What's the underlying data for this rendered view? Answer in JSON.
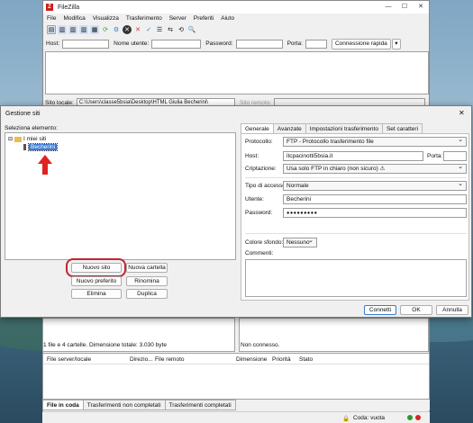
{
  "app": {
    "title": "FileZilla",
    "menu": [
      "File",
      "Modifica",
      "Visualizza",
      "Trasferimento",
      "Server",
      "Preferiti",
      "Aiuto"
    ],
    "window_buttons": [
      "—",
      "☐",
      "✕"
    ]
  },
  "quickconnect": {
    "host_label": "Host:",
    "user_label": "Nome utente:",
    "password_label": "Password:",
    "port_label": "Porta:",
    "connect_button": "Connessione rapida",
    "dropdown_arrow": "▾"
  },
  "local_site": {
    "label": "Sito locale:",
    "path": "C:\\Users\\classe5bsia\\Desktop\\HTML Giulia Becherini\\"
  },
  "remote_site": {
    "label": "Sito remoto:"
  },
  "status": {
    "local": "1 file e 4 cartelle. Dimensione totale: 3.030 byte",
    "remote": "Non connesso.",
    "queue": "Coda: vuota"
  },
  "queue_columns": [
    "File server/locale",
    "Direzio...",
    "File remoto",
    "Dimensione",
    "Priorità",
    "Stato"
  ],
  "bottom_tabs": [
    "File in coda",
    "Trasferimenti non completati",
    "Trasferimenti completati"
  ],
  "dialog": {
    "title": "Gestione siti",
    "select_label": "Seleziona elemento:",
    "tree_root": "I miei siti",
    "tree_child": "Becherini",
    "buttons": {
      "new_site": "Nuovo sito",
      "new_folder": "Nuova cartella",
      "new_bookmark": "Nuovo preferito",
      "rename": "Rinomina",
      "delete": "Elimina",
      "duplicate": "Duplica",
      "connect": "Connetti",
      "ok": "OK",
      "cancel": "Annulla"
    },
    "tabs": [
      "Generale",
      "Avanzate",
      "Impostazioni trasferimento",
      "Set caratteri"
    ],
    "form": {
      "protocol_label": "Protocollo:",
      "protocol_value": "FTP - Protocollo trasferimento file",
      "host_label": "Host:",
      "host_value": "itcpacinotti5bsia.it",
      "port_label": "Porta:",
      "encryption_label": "Criptazione:",
      "encryption_value": "Usa solo FTP in chiaro (non sicuro) ⚠",
      "logon_label": "Tipo di accesso:",
      "logon_value": "Normale",
      "user_label": "Utente:",
      "user_value": "Becherini",
      "password_label": "Password:",
      "password_value": "●●●●●●●●●",
      "bgcolor_label": "Colore sfondo:",
      "bgcolor_value": "Nessuno",
      "comments_label": "Commenti:"
    },
    "close_icon": "✕"
  },
  "colors": {
    "highlight_circle": "#c0272d",
    "arrow": "#e0211f",
    "selection": "#3a7bd5"
  }
}
